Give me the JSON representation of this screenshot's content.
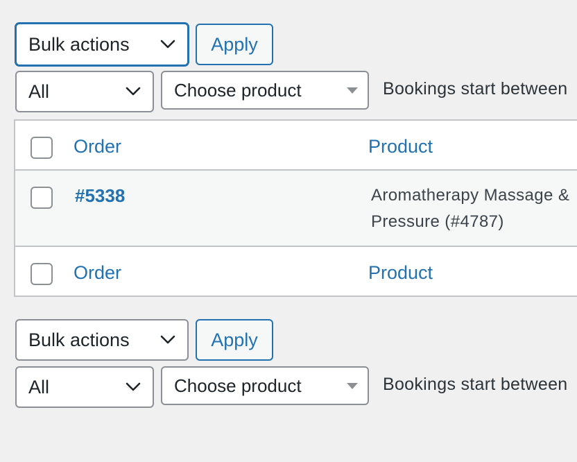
{
  "top_nav": {
    "bulk_actions": {
      "selected": "Bulk actions"
    },
    "apply_label": "Apply",
    "filter_all": {
      "selected": "All"
    },
    "product_select": {
      "selected": "Choose product"
    },
    "date_filter_label": "Bookings start between"
  },
  "table": {
    "header": {
      "order": "Order",
      "product": "Product"
    },
    "rows": [
      {
        "order": "#5338",
        "product_line1": "Aromatherapy Massage &",
        "product_line2": "Pressure (#4787)"
      }
    ],
    "footer": {
      "order": "Order",
      "product": "Product"
    }
  },
  "bottom_nav": {
    "bulk_actions": {
      "selected": "Bulk actions"
    },
    "apply_label": "Apply",
    "filter_all": {
      "selected": "All"
    },
    "product_select": {
      "selected": "Choose product"
    },
    "date_filter_label": "Bookings start between"
  },
  "colors": {
    "accent": "#2271b1",
    "background": "#f0f0f1",
    "row_alt": "#f6f7f7",
    "border": "#c3c4c7"
  }
}
